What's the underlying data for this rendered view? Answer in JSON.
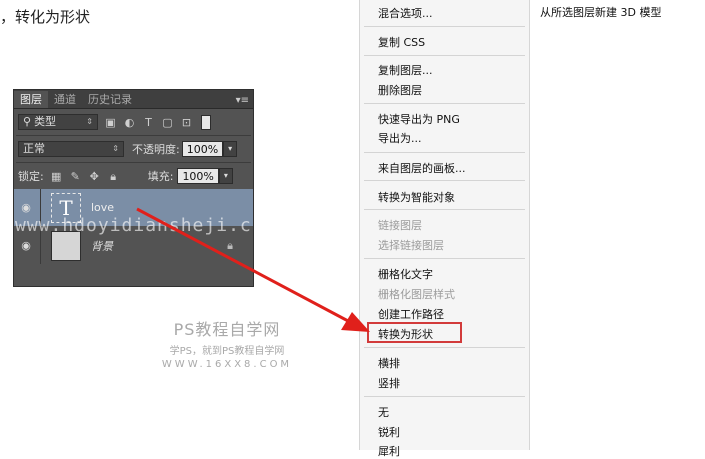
{
  "top_text": "，转化为形状",
  "watermark": "www.hdoyidiansheji.c",
  "layers_panel": {
    "tabs": [
      "图层",
      "通道",
      "历史记录"
    ],
    "menu_button": "▾≡",
    "filter_label": "类型",
    "blend_mode": "正常",
    "opacity_label": "不透明度:",
    "opacity_value": "100%",
    "lock_label": "锁定:",
    "fill_label": "填充:",
    "fill_value": "100%",
    "layers": [
      {
        "name": "love",
        "thumb": "T",
        "selected": true
      },
      {
        "name": "背景",
        "thumb": "",
        "selected": false,
        "locked": true
      }
    ]
  },
  "logo": {
    "line1": "PS教程自学网",
    "line2": "学PS，就到PS教程自学网",
    "line3": "WWW.16XX8.COM"
  },
  "context_menu": {
    "items": [
      "混合选项...",
      "复制 CSS",
      "复制图层...",
      "删除图层",
      "快速导出为 PNG",
      "导出为...",
      "来自图层的画板...",
      "转换为智能对象",
      "链接图层",
      "选择链接图层",
      "栅格化文字",
      "栅格化图层样式",
      "创建工作路径",
      "转换为形状",
      "横排",
      "竖排",
      "无",
      "锐利",
      "犀利"
    ],
    "highlighted": "转换为形状"
  },
  "submenu_item": "从所选图层新建 3D 模型",
  "colors": {
    "arrow": "#e0201b",
    "highlight": "#d23a3a",
    "selected_layer": "#7b8ea6"
  }
}
